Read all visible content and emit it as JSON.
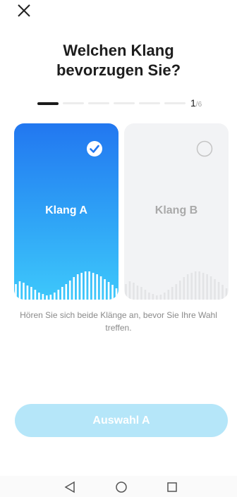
{
  "header": {
    "close_icon": "close-icon",
    "title_line1": "Welchen Klang",
    "title_line2": "bevorzugen Sie?"
  },
  "progress": {
    "current": "1",
    "total": "/6",
    "steps": 6,
    "active_step": 1
  },
  "cards": [
    {
      "label": "Klang A",
      "selected": true
    },
    {
      "label": "Klang B",
      "selected": false
    }
  ],
  "hint": "Hören Sie sich beide Klänge an, bevor Sie Ihre Wahl treffen.",
  "cta": {
    "label": "Auswahl A"
  },
  "nav": {
    "back_icon": "triangle-back-icon",
    "home_icon": "circle-home-icon",
    "recents_icon": "square-recents-icon"
  },
  "colors": {
    "accent_start": "#2277f0",
    "accent_end": "#3ec8fb",
    "cta_bg": "#b5e6f9"
  }
}
